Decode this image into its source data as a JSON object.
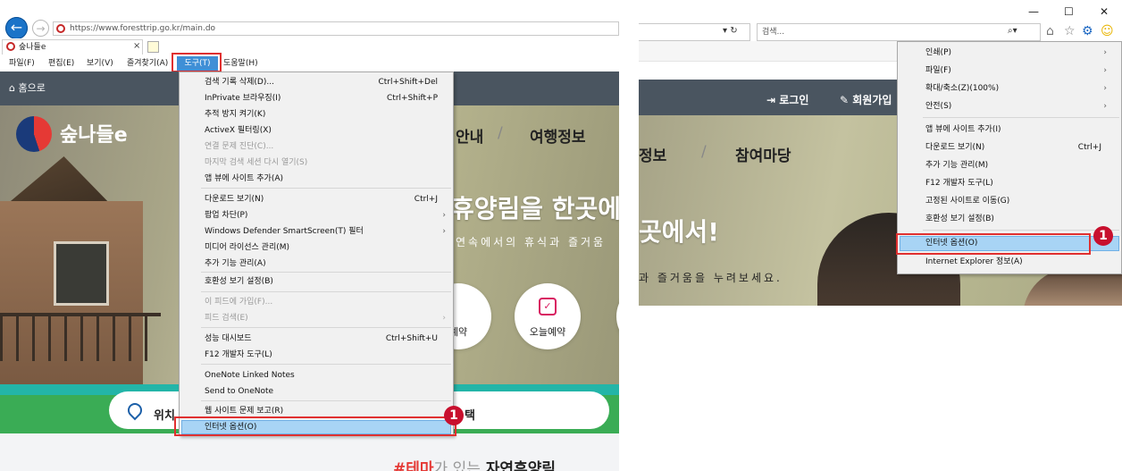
{
  "left": {
    "url": "https://www.foresttrip.go.kr/main.do",
    "tab_title": "숲나들e",
    "tab_close": "×",
    "menubar": [
      "파일(F)",
      "편집(E)",
      "보기(V)",
      "즐겨찾기(A)",
      "도구(T)",
      "도움말(H)"
    ],
    "page": {
      "home": "⌂ 홈으로",
      "logo_text": "숲나들e",
      "nav1": "안내",
      "nav_slash": "/",
      "nav2": "여행정보",
      "hero_title": "휴양림을 한곳에서",
      "hero_sub": "연속에서의 휴식과 즐거움",
      "circle1_label": "예약",
      "circle2_label": "오늘예약",
      "pill_left": "위치",
      "pill_right": "택",
      "bottom_hash": "#테마",
      "bottom_mid": "가 있는",
      "bottom_end": "자연휴양림"
    },
    "tools_menu": [
      {
        "label": "검색 기록 삭제(D)...",
        "shortcut": "Ctrl+Shift+Del"
      },
      {
        "label": "InPrivate 브라우징(I)",
        "shortcut": "Ctrl+Shift+P"
      },
      {
        "label": "추적 방지 켜기(K)",
        "shortcut": ""
      },
      {
        "label": "ActiveX 필터링(X)",
        "shortcut": ""
      },
      {
        "label": "연결 문제 진단(C)...",
        "shortcut": "",
        "disabled": true
      },
      {
        "label": "마지막 검색 세션 다시 열기(S)",
        "shortcut": "",
        "disabled": true
      },
      {
        "label": "앱 뷰에 사이트 추가(A)",
        "shortcut": ""
      },
      {
        "label": "다운로드 보기(N)",
        "shortcut": "Ctrl+J"
      },
      {
        "label": "팝업 차단(P)",
        "shortcut": "",
        "submenu": true
      },
      {
        "label": "Windows Defender SmartScreen(T) 필터",
        "shortcut": "",
        "submenu": true
      },
      {
        "label": "미디어 라이선스 관리(M)",
        "shortcut": ""
      },
      {
        "label": "추가 기능 관리(A)",
        "shortcut": ""
      },
      {
        "label": "호환성 보기 설정(B)",
        "shortcut": ""
      },
      {
        "label": "이 피드에 가입(F)...",
        "shortcut": "",
        "disabled": true
      },
      {
        "label": "피드 검색(E)",
        "shortcut": "",
        "disabled": true,
        "submenu": true
      },
      {
        "label": "성능 대시보드",
        "shortcut": "Ctrl+Shift+U"
      },
      {
        "label": "F12 개발자 도구(L)",
        "shortcut": ""
      },
      {
        "label": "OneNote Linked Notes",
        "shortcut": ""
      },
      {
        "label": "Send to OneNote",
        "shortcut": ""
      },
      {
        "label": "웹 사이트 문제 보고(R)",
        "shortcut": ""
      },
      {
        "label": "인터넷 옵션(O)",
        "shortcut": "",
        "highlighted": true
      }
    ],
    "badge": "1"
  },
  "right": {
    "window_controls": [
      "—",
      "☐",
      "✕"
    ],
    "search_placeholder": "검색...",
    "addr_arrows": "▾ ↻",
    "search_icon": "⌕▾",
    "page": {
      "login": "로그인",
      "join": "회원가입",
      "nav1": "정보",
      "nav_slash": "/",
      "nav2": "참여마당",
      "hero_title": "곳에서!",
      "hero_sub": "과 즐거움을 누려보세요."
    },
    "gear_menu": [
      {
        "label": "인쇄(P)",
        "shortcut": "",
        "submenu": true
      },
      {
        "label": "파일(F)",
        "shortcut": "",
        "submenu": true
      },
      {
        "label": "확대/축소(Z)(100%)",
        "shortcut": "",
        "submenu": true
      },
      {
        "label": "안전(S)",
        "shortcut": "",
        "submenu": true
      },
      {
        "label": "앱 뷰에 사이트 추가(I)",
        "shortcut": ""
      },
      {
        "label": "다운로드 보기(N)",
        "shortcut": "Ctrl+J"
      },
      {
        "label": "추가 기능 관리(M)",
        "shortcut": ""
      },
      {
        "label": "F12 개발자 도구(L)",
        "shortcut": ""
      },
      {
        "label": "고정된 사이트로 이동(G)",
        "shortcut": ""
      },
      {
        "label": "호환성 보기 설정(B)",
        "shortcut": ""
      },
      {
        "label": "인터넷 옵션(O)",
        "shortcut": "",
        "highlighted": true
      },
      {
        "label": "Internet Explorer 정보(A)",
        "shortcut": ""
      }
    ],
    "badge": "1"
  },
  "colors": {
    "accent": "#3f8fd6",
    "highlight": "#a8d4f5",
    "callout_red": "#e03030",
    "badge": "#c8102e",
    "nav_dark": "#4a5560",
    "green": "#3aac55"
  }
}
